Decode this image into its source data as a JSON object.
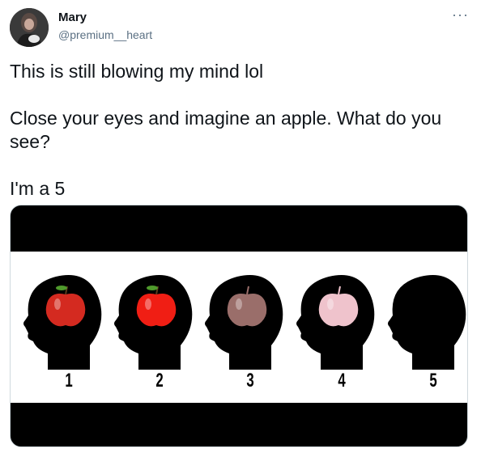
{
  "author": {
    "name": "Mary",
    "handle": "@premium__heart"
  },
  "more_icon": "more-horizontal-icon",
  "tweet": {
    "lines": [
      "This is still blowing my mind lol",
      "Close your eyes and imagine an apple. What do you see?",
      "I'm a 5"
    ]
  },
  "image": {
    "labels": [
      "1",
      "2",
      "3",
      "4",
      "5"
    ],
    "apple_colors": [
      "#d42a20",
      "#f01e14",
      "#9a6e6a",
      "#efc3cc",
      null
    ]
  }
}
